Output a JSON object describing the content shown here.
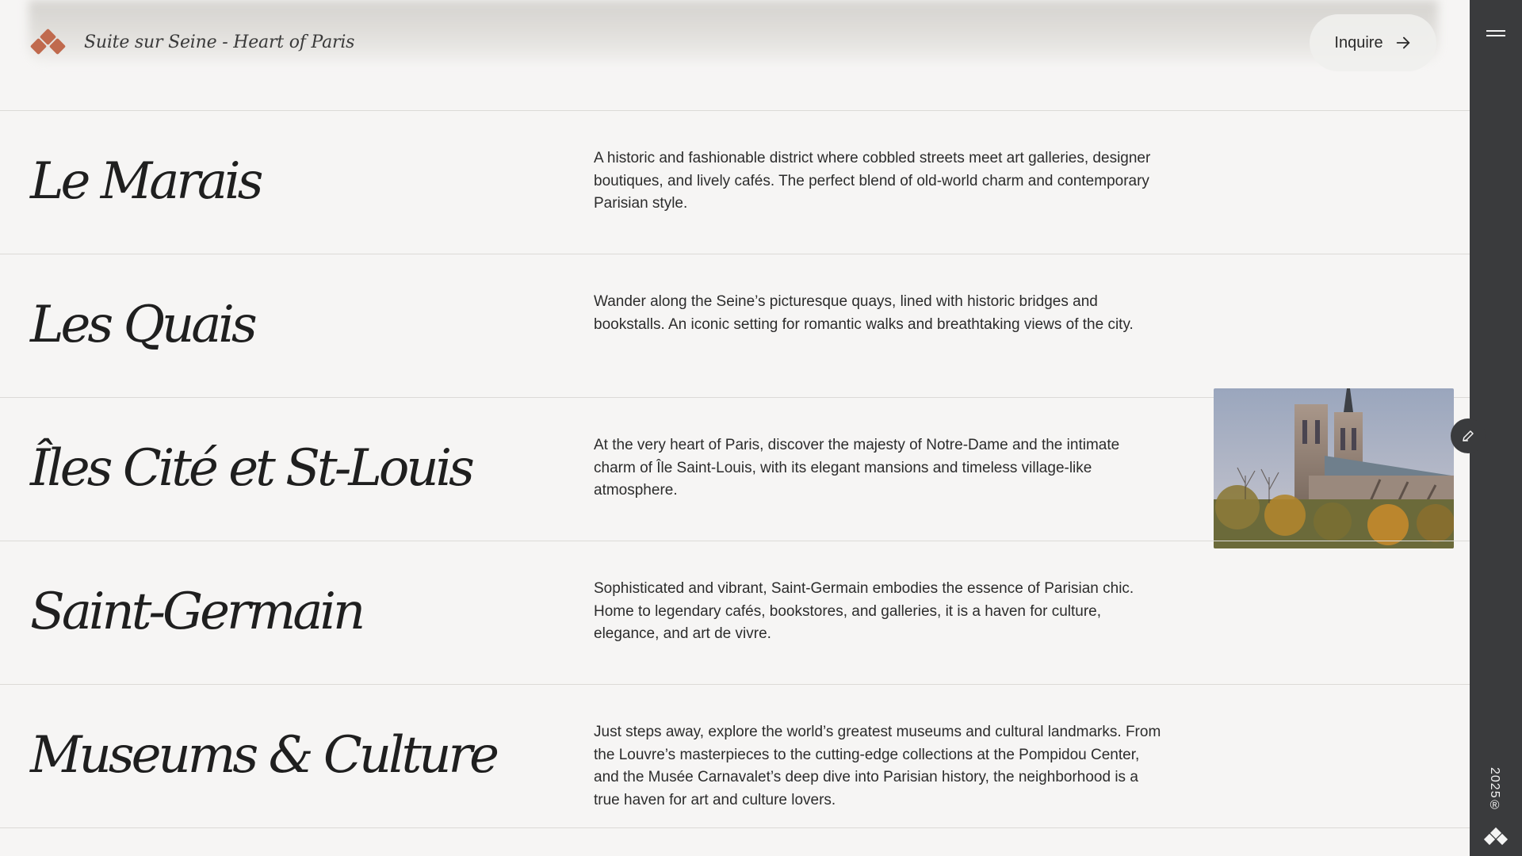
{
  "header": {
    "brand_name": "Suite sur Seine - Heart of Paris",
    "inquire_label": "Inquire"
  },
  "sidebar": {
    "year": "2025"
  },
  "neighborhoods": [
    {
      "title": "Le Marais",
      "description": "A historic and fashionable district where cobbled streets meet art galleries, designer boutiques, and lively cafés. The perfect blend of old-world charm and contemporary Parisian style."
    },
    {
      "title": "Les Quais",
      "description": "Wander along the Seine’s picturesque quays, lined with historic bridges and bookstalls. An iconic setting for romantic walks and breathtaking views of the city."
    },
    {
      "title": "Îles Cité et St-Louis",
      "description": "At the very heart of Paris, discover the majesty of Notre-Dame and the intimate charm of Île Saint-Louis, with its elegant mansions and timeless village-like atmosphere."
    },
    {
      "title": "Saint-Germain",
      "description": "Sophisticated and vibrant, Saint-Germain embodies the essence of Parisian chic. Home to legendary cafés, bookstores, and galleries, it is a haven for culture, elegance, and art de vivre."
    },
    {
      "title": "Museums & Culture",
      "description": "Just steps away, explore the world’s greatest museums and cultural landmarks. From the Louvre’s masterpieces to the cutting-edge collections at the Pompidou Center, and the Musée Carnavalet’s deep dive into Parisian history, the neighborhood is a true haven for art and culture lovers."
    }
  ],
  "colors": {
    "accent": "#c06a4e",
    "sidebar": "#3a3b3d",
    "background": "#f6f5f4"
  }
}
